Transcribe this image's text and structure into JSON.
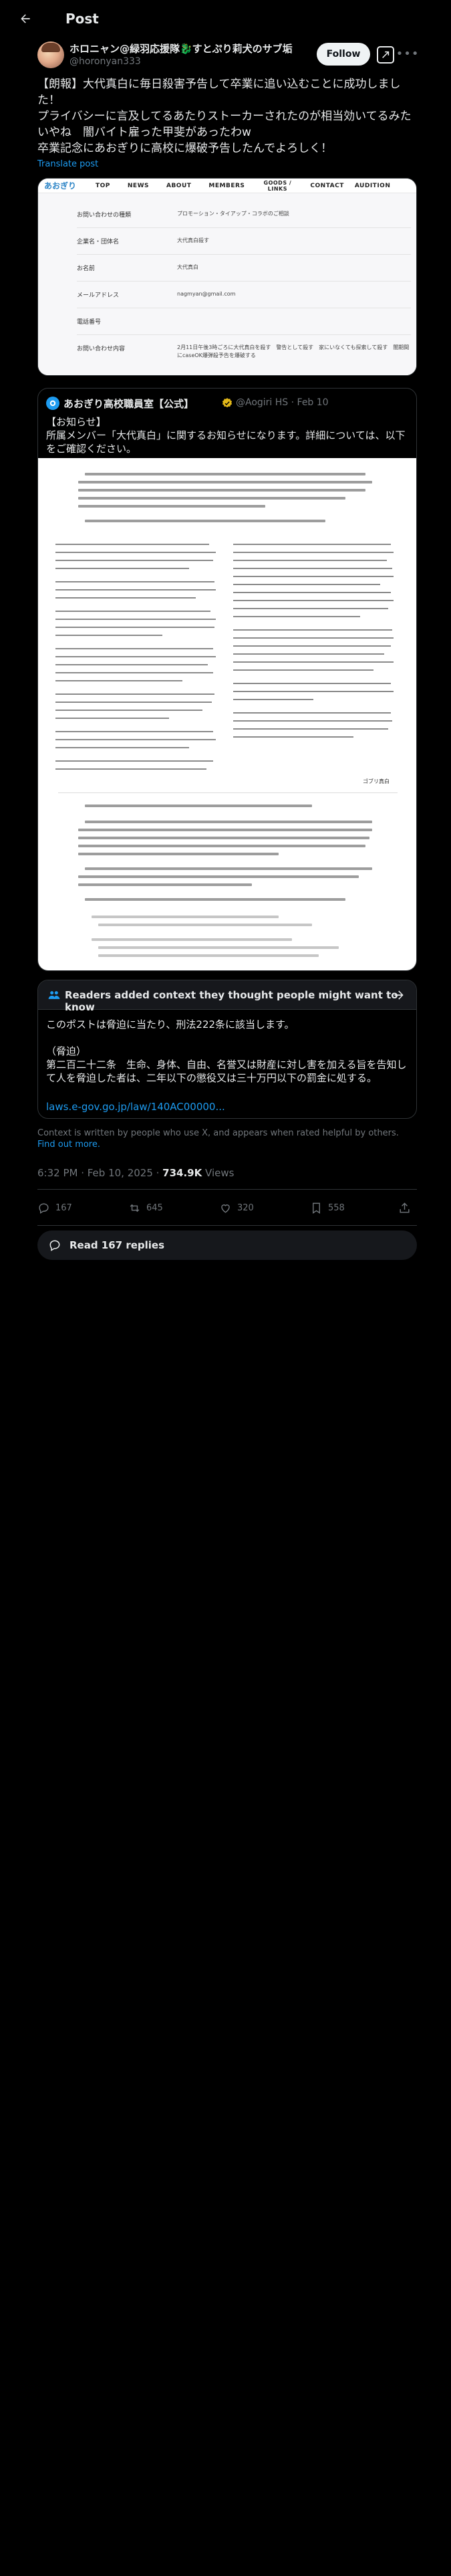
{
  "header": {
    "title": "Post"
  },
  "author": {
    "name": "ホロニャン@緑羽応援隊🐉すとぷり莉犬のサブ垢",
    "handle": "@horonyan333",
    "follow_label": "Follow"
  },
  "post": {
    "text": "【朗報】大代真白に毎日殺害予告して卒業に追い込むことに成功しました！\nプライバシーに言及してるあたりストーカーされたのが相当効いてるみたいやね　闇バイト雇った甲斐があったわw\n卒業記念にあおぎりに高校に爆破予告したんでよろしく！",
    "translate_label": "Translate post"
  },
  "media1": {
    "site_logo": "あおぎり",
    "nav": [
      "TOP",
      "NEWS",
      "ABOUT",
      "MEMBERS",
      "GOODS / LINKS",
      "CONTACT",
      "AUDITION"
    ],
    "rows": [
      {
        "label": "お問い合わせの種類",
        "value": "プロモーション・タイアップ・コラボのご相談"
      },
      {
        "label": "企業名・団体名",
        "value": "大代真白殺す"
      },
      {
        "label": "お名前",
        "value": "大代真白"
      },
      {
        "label": "メールアドレス",
        "value": "nagmyan@gmail.com"
      },
      {
        "label": "電話番号",
        "value": ""
      },
      {
        "label": "お問い合わせ内容",
        "value": "2月11日午後3時ごろに大代真白を殺す　警告として殺す　家にいなくても探索して殺す　闇期間にcaseOK爆弾殺予告を爆破する"
      }
    ]
  },
  "quote": {
    "name": "あおぎり高校職員室【公式】",
    "meta": "@Aogiri HS · Feb 10",
    "text": "【お知らせ】\n所属メンバー「大代真白」に関するお知らせになります。詳細については、以下をご確認ください。",
    "doc_sign": "ゴブリ真白"
  },
  "note": {
    "title": "Readers added context they thought people might want to know",
    "body": "このポストは脅迫に当たり、刑法222条に該当します。\n\n（脅迫）\n第二百二十二条　生命、身体、自由、名誉又は財産に対し害を加える旨を告知して人を脅迫した者は、二年以下の懲役又は三十万円以下の罰金に処する。",
    "link": "laws.e-gov.go.jp/law/140AC00000...",
    "footer_text": "Context is written by people who use X, and appears when rated helpful by others.",
    "footer_link": "Find out more."
  },
  "meta": {
    "time": "6:32 PM · Feb 10, 2025 · ",
    "views": "734.9K",
    "views_label": " Views"
  },
  "actions": {
    "replies": "167",
    "reposts": "645",
    "likes": "320",
    "bookmarks": "558"
  },
  "read_replies": "Read 167 replies",
  "colors": {
    "accent": "#1d9bf0",
    "background": "#000000",
    "muted": "#71767b"
  },
  "icons": [
    "back-arrow-icon",
    "grok-icon",
    "more-icon",
    "verified-icon",
    "people-icon",
    "arrow-right-icon",
    "reply-icon",
    "repost-icon",
    "like-icon",
    "bookmark-icon",
    "share-icon",
    "chat-bubble-icon"
  ]
}
